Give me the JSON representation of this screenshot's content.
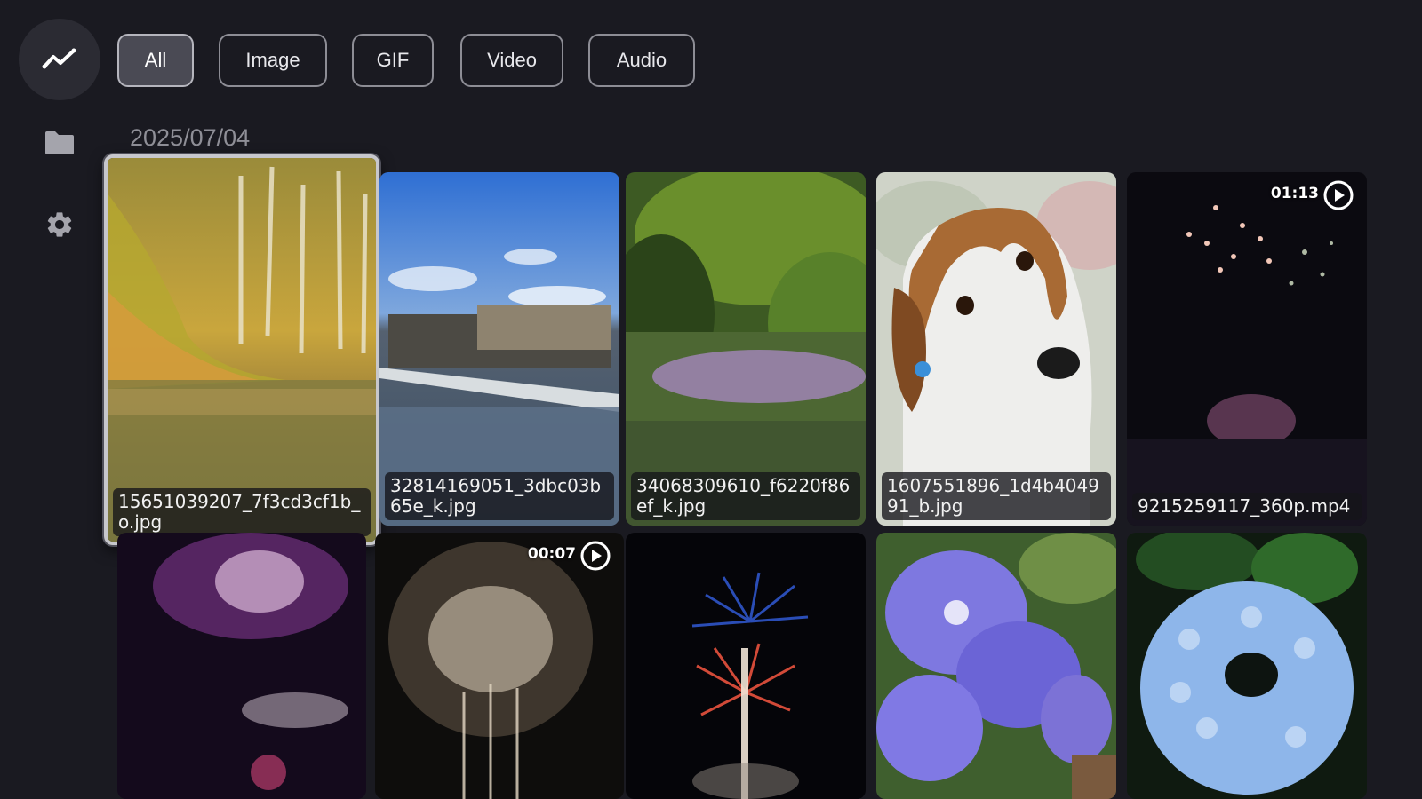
{
  "sidebar": {
    "items": [
      {
        "icon": "trending-icon"
      },
      {
        "icon": "folder-icon"
      },
      {
        "icon": "gear-icon"
      }
    ]
  },
  "filters": [
    {
      "label": "All",
      "selected": true
    },
    {
      "label": "Image",
      "selected": false
    },
    {
      "label": "GIF",
      "selected": false
    },
    {
      "label": "Video",
      "selected": false
    },
    {
      "label": "Audio",
      "selected": false
    }
  ],
  "group": {
    "date": "2025/07/04",
    "items": [
      {
        "caption": "15651039207_7f3cd3cf1b_o.jpg",
        "focused": true
      },
      {
        "caption": "32814169051_3dbc03b65e_k.jpg"
      },
      {
        "caption": "34068309610_f6220f86ef_k.jpg"
      },
      {
        "caption": "1607551896_1d4b404991_b.jpg"
      },
      {
        "caption": "9215259117_360p.mp4",
        "duration": "01:13",
        "is_video": true
      },
      {
        "caption": ""
      },
      {
        "caption": "",
        "duration": "00:07",
        "is_video": true
      },
      {
        "caption": ""
      },
      {
        "caption": ""
      },
      {
        "caption": ""
      }
    ]
  },
  "colors": {
    "background": "#1a1a21",
    "chip_selected": "#4a4a54",
    "chip_border": "#8d8d95"
  }
}
